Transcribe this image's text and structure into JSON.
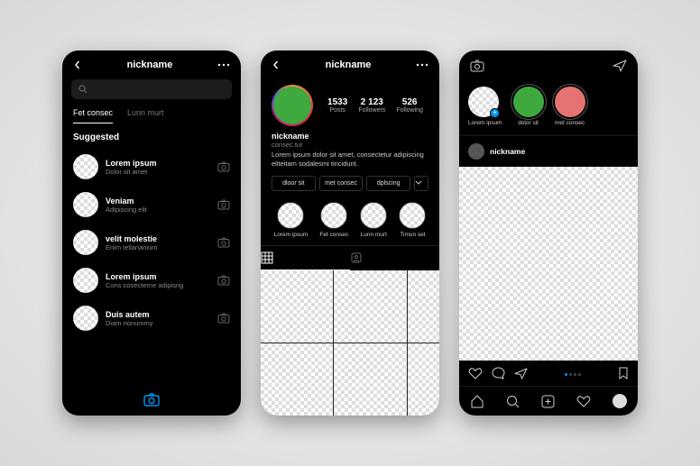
{
  "screen1": {
    "title": "nickname",
    "tabs": [
      "Fet consec",
      "Lunn murt"
    ],
    "suggested_header": "Suggested",
    "users": [
      {
        "name": "Lorem ipsum",
        "sub": "Dolor sit amet"
      },
      {
        "name": "Veniam",
        "sub": "Adipiscing elit"
      },
      {
        "name": "velit molestie",
        "sub": "Enim tellarianium"
      },
      {
        "name": "Lorem ipsum",
        "sub": "Cons cosecterne adipisng"
      },
      {
        "name": "Duis autem",
        "sub": "Diam nonummy"
      }
    ]
  },
  "screen2": {
    "title": "nickname",
    "stats": [
      {
        "n": "1533",
        "l": "Posts"
      },
      {
        "n": "2 123",
        "l": "Followers"
      },
      {
        "n": "526",
        "l": "Following"
      }
    ],
    "username": "nickname",
    "category": "consec.tur",
    "bio": "Lorem ipsum dolor sit amet, consectetur adipiscing eliteitam sodalesmi tincidunt.",
    "buttons": [
      "dloor sit",
      "met consec",
      "dplscing"
    ],
    "highlights": [
      {
        "l": "Lorem ipsum"
      },
      {
        "l": "Fet consec"
      },
      {
        "l": "Lunn murt"
      },
      {
        "l": "Timun set"
      }
    ]
  },
  "screen3": {
    "stories": [
      {
        "l": "Lorem ipsum",
        "color": "checker",
        "own": true
      },
      {
        "l": "dolor sit",
        "color": "#3fa83f"
      },
      {
        "l": "met consec",
        "color": "#e57373"
      }
    ],
    "post_user": "nickname"
  }
}
